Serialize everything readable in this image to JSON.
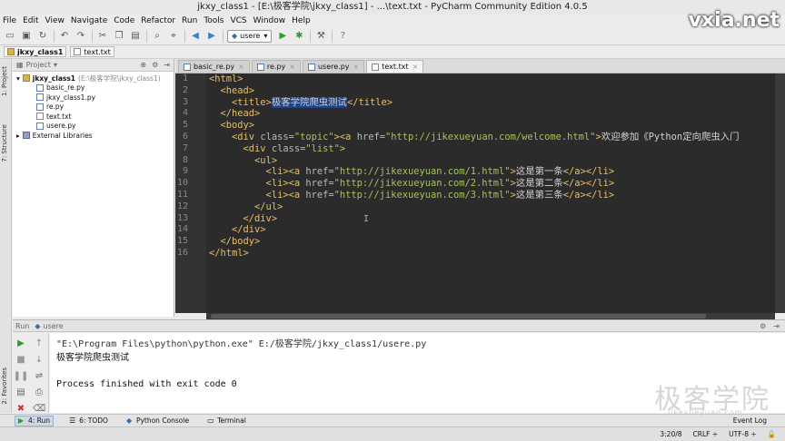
{
  "window": {
    "title": "jkxy_class1 - [E:\\极客学院\\jkxy_class1] - ...\\text.txt - PyCharm Community Edition 4.0.5",
    "watermark": "vxia.net"
  },
  "menu": [
    "File",
    "Edit",
    "View",
    "Navigate",
    "Code",
    "Refactor",
    "Run",
    "Tools",
    "VCS",
    "Window",
    "Help"
  ],
  "toolbar": {
    "run_config": "usere"
  },
  "breadcrumb": [
    "jkxy_class1",
    "text.txt"
  ],
  "left_stripe": {
    "project_label": "1: Project",
    "structure_label": "7: Structure",
    "favorites_label": "2: Favorites"
  },
  "project_panel": {
    "header": "Project",
    "root": "jkxy_class1",
    "root_path": "(E:\\极客学院\\jkxy_class1)",
    "files": [
      "basic_re.py",
      "jkxy_class1.py",
      "re.py",
      "text.txt",
      "usere.py"
    ],
    "libraries": "External Libraries"
  },
  "editor": {
    "tabs": [
      {
        "label": "basic_re.py",
        "active": false
      },
      {
        "label": "re.py",
        "active": false
      },
      {
        "label": "usere.py",
        "active": false
      },
      {
        "label": "text.txt",
        "active": true
      }
    ],
    "line_numbers": [
      "1",
      "2",
      "3",
      "4",
      "5",
      "6",
      "7",
      "8",
      "9",
      "10",
      "11",
      "12",
      "13",
      "14",
      "15",
      "16"
    ],
    "code": {
      "l1": "<html>",
      "l2": "  <head>",
      "l3_open": "    <title>",
      "l3_sel": "极客学院爬虫测试",
      "l3_close": "</title>",
      "l4": "  </head>",
      "l5": "  <body>",
      "l6_tag": "    <div ",
      "l6_attr": "class=",
      "l6_val": "\"topic\"",
      "l6_tag2": "><a ",
      "l6_attr2": "href=",
      "l6_val2": "\"http://jikexueyuan.com/welcome.html\"",
      "l6_tag3": ">",
      "l6_text": "欢迎参加《Python定向爬虫入门",
      "l7_tag": "      <div ",
      "l7_attr": "class=",
      "l7_val": "\"list\"",
      "l7_tag2": ">",
      "l8": "        <ul>",
      "l9_tag": "          <li><a ",
      "l9_attr": "href=",
      "l9_val": "\"http://jikexueyuan.com/1.html\"",
      "l9_tag2": ">",
      "l9_text": "这是第一条",
      "l9_tag3": "</a></li>",
      "l10_tag": "          <li><a ",
      "l10_attr": "href=",
      "l10_val": "\"http://jikexueyuan.com/2.html\"",
      "l10_tag2": ">",
      "l10_text": "这是第二条",
      "l10_tag3": "</a></li>",
      "l11_tag": "          <li><a ",
      "l11_attr": "href=",
      "l11_val": "\"http://jikexueyuan.com/3.html\"",
      "l11_tag2": ">",
      "l11_text": "这是第三条",
      "l11_tag3": "</a></li>",
      "l12": "        </ul>",
      "l13": "      </div>",
      "l14": "    </div>",
      "l15": "  </body>",
      "l16": "</html>"
    },
    "caret": "I"
  },
  "run_panel": {
    "label": "Run",
    "config": "usere",
    "output": [
      "\"E:\\Program Files\\python\\python.exe\" E:/极客学院/jkxy_class1/usere.py",
      "极客学院爬虫测试",
      "",
      "Process finished with exit code 0"
    ]
  },
  "bottom_tools": [
    {
      "label": "4: Run",
      "active": true
    },
    {
      "label": "6: TODO",
      "active": false
    },
    {
      "label": "Python Console",
      "active": false
    },
    {
      "label": "Terminal",
      "active": false
    }
  ],
  "event_log": "Event Log",
  "status": {
    "position": "3:20/8",
    "line_sep": "CRLF ÷",
    "encoding": "UTF-8 ÷"
  },
  "logo": {
    "text": "极客学院",
    "sub": "jikexueyuan.com"
  }
}
